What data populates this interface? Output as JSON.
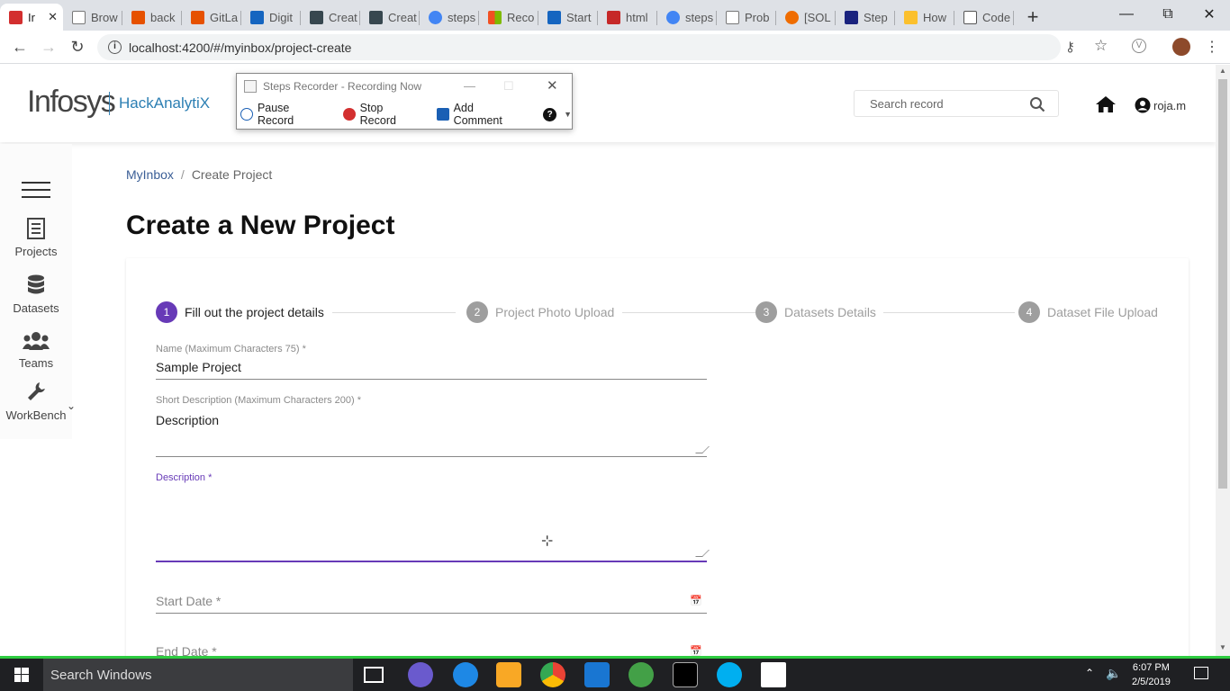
{
  "browser": {
    "tabs": [
      {
        "label": "Ir",
        "color": "#d32f2f",
        "active": true
      },
      {
        "label": "Brow",
        "color": "#9e9e9e"
      },
      {
        "label": "back",
        "color": "#e65100"
      },
      {
        "label": "GitLa",
        "color": "#e65100"
      },
      {
        "label": "Digit",
        "color": "#1565c0"
      },
      {
        "label": "Creat",
        "color": "#37474f"
      },
      {
        "label": "Creat",
        "color": "#37474f"
      },
      {
        "label": "steps",
        "color": "#4285f4"
      },
      {
        "label": "Reco",
        "color": "#f25022"
      },
      {
        "label": "Start",
        "color": "#1565c0"
      },
      {
        "label": "html",
        "color": "#c62828"
      },
      {
        "label": "steps",
        "color": "#4285f4"
      },
      {
        "label": "Prob",
        "color": "#9e9e9e"
      },
      {
        "label": "[SOL",
        "color": "#ef6c00"
      },
      {
        "label": "Step",
        "color": "#1a237e"
      },
      {
        "label": "How",
        "color": "#fbc02d"
      },
      {
        "label": "Code",
        "color": "#555555"
      }
    ],
    "tab_close": "✕",
    "new_tab": "+",
    "url": "localhost:4200/#/myinbox/project-create"
  },
  "recorder": {
    "title": "Steps Recorder - Recording Now",
    "pause": "Pause Record",
    "stop": "Stop Record",
    "comment": "Add Comment"
  },
  "header": {
    "logo": "Infosys",
    "app_name": "HackAnalytiX",
    "search_placeholder": "Search record",
    "user": "roja.m"
  },
  "sidebar": {
    "projects": "Projects",
    "datasets": "Datasets",
    "teams": "Teams",
    "workbench": "WorkBench"
  },
  "breadcrumb": {
    "root": "MyInbox",
    "separator": "/",
    "current": "Create Project"
  },
  "page": {
    "title": "Create a New Project"
  },
  "stepper": {
    "steps": [
      {
        "num": "1",
        "label": "Fill out the project details"
      },
      {
        "num": "2",
        "label": "Project Photo Upload"
      },
      {
        "num": "3",
        "label": "Datasets Details"
      },
      {
        "num": "4",
        "label": "Dataset File Upload"
      }
    ]
  },
  "form": {
    "name_label": "Name (Maximum Characters 75) *",
    "name_value": "Sample Project",
    "short_desc_label": "Short Description (Maximum Characters 200) *",
    "short_desc_value": "Description",
    "desc_label": "Description *",
    "desc_value": "",
    "start_date_label": "Start Date *",
    "end_date_label": "End Date *"
  },
  "taskbar": {
    "search": "Search Windows",
    "time": "6:07 PM",
    "date": "2/5/2019"
  },
  "colors": {
    "accent": "#673ab7",
    "brand": "#2c7fb3",
    "taskbar_indicator": "#2ecc40"
  }
}
